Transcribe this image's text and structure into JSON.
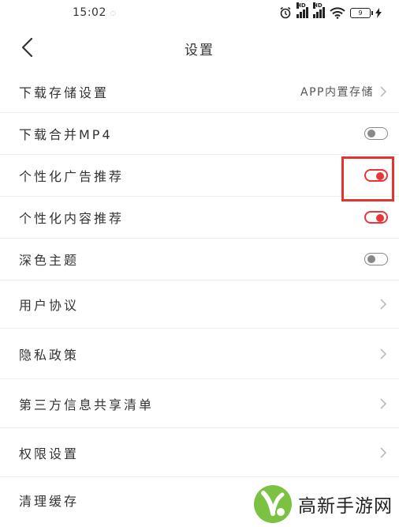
{
  "status_bar": {
    "time": "15:02",
    "battery_level": "9",
    "network_label": "HD"
  },
  "nav": {
    "title": "设置"
  },
  "settings": [
    {
      "label": "下载存储设置",
      "type": "link",
      "value": "APP内置存储"
    },
    {
      "label": "下载合并MP4",
      "type": "toggle",
      "on": false
    },
    {
      "label": "个性化广告推荐",
      "type": "toggle",
      "on": true
    },
    {
      "label": "个性化内容推荐",
      "type": "toggle",
      "on": true
    },
    {
      "label": "深色主题",
      "type": "toggle",
      "on": false
    },
    {
      "label": "用户协议",
      "type": "link",
      "value": ""
    },
    {
      "label": "隐私政策",
      "type": "link",
      "value": ""
    },
    {
      "label": "第三方信息共享清单",
      "type": "link",
      "value": ""
    },
    {
      "label": "权限设置",
      "type": "link",
      "value": ""
    },
    {
      "label": "清理缓存",
      "type": "link",
      "value": ""
    }
  ],
  "watermark": {
    "text": "高新手游网"
  },
  "colors": {
    "accent": "#e8363a",
    "highlight": "#e5342f",
    "watermark_green": "#7cc242"
  }
}
